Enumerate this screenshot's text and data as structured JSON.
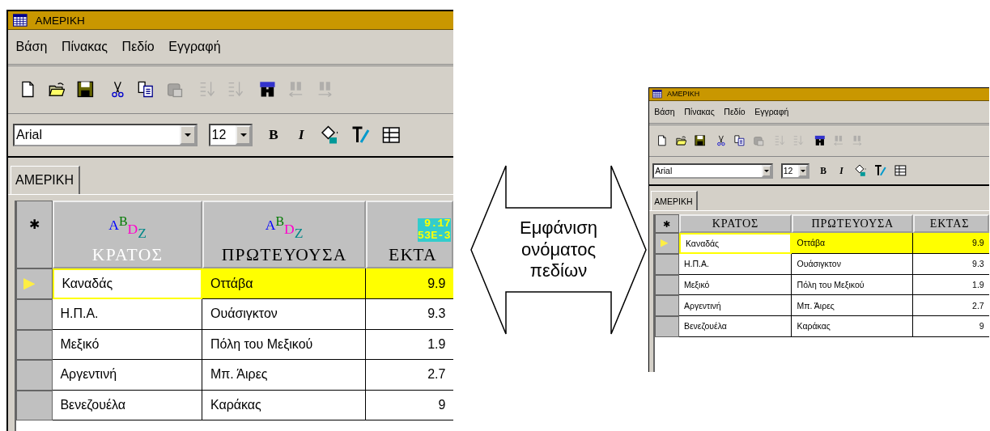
{
  "windows": [
    {
      "kind": "large",
      "title": "ΑΜΕΡΙΚΗ",
      "menu": [
        "Βάση",
        "Πίνακας",
        "Πεδίο",
        "Εγγραφή"
      ],
      "toolbar": [
        [
          {
            "kind": "new",
            "disabled": false
          },
          {
            "kind": "open",
            "disabled": false
          },
          {
            "kind": "save",
            "disabled": false
          }
        ],
        [
          {
            "kind": "cut",
            "disabled": false
          },
          {
            "kind": "copy",
            "disabled": false
          },
          {
            "kind": "paste",
            "disabled": true
          }
        ],
        [
          {
            "kind": "sort_asc",
            "disabled": true
          },
          {
            "kind": "sort_desc",
            "disabled": true
          }
        ],
        [
          {
            "kind": "find",
            "disabled": false
          },
          {
            "kind": "find_prev",
            "disabled": true
          },
          {
            "kind": "find_next",
            "disabled": true
          }
        ]
      ],
      "font_field": "Arial",
      "size_field": "12",
      "style_buttons": [
        {
          "kind": "bold",
          "label": "B"
        },
        {
          "kind": "italic",
          "label": "I"
        }
      ],
      "format_tools": [
        {
          "kind": "fill"
        },
        {
          "kind": "text_color"
        },
        {
          "kind": "grid"
        }
      ],
      "tabs": [
        {
          "label": "ΑΜΕΡΙΚΗ",
          "selected": true
        }
      ],
      "corner": "✱",
      "columns": [
        {
          "label": "ΚΡΑΤΟΣ",
          "dimmed": true,
          "type_icon": "ABDZ"
        },
        {
          "label": "ΠΡΩΤΕΥΟΥΣΑ",
          "dimmed": false,
          "type_icon": "ABDZ"
        },
        {
          "label": "ΕΚΤΑ",
          "dimmed": false,
          "number_icon": [
            "9.17",
            "53E-3"
          ]
        }
      ],
      "rows": [
        {
          "selected": true,
          "cells": [
            "Καναδάς",
            "Οττάβα",
            "9.9"
          ]
        },
        {
          "selected": false,
          "cells": [
            "Η.Π.Α.",
            "Ουάσιγκτον",
            "9.3"
          ]
        },
        {
          "selected": false,
          "cells": [
            "Μεξικό",
            "Πόλη του Μεξικού",
            "1.9"
          ]
        },
        {
          "selected": false,
          "cells": [
            "Αργεντινή",
            "Μπ. Άιρες",
            "2.7"
          ]
        },
        {
          "selected": false,
          "cells": [
            "Βενεζουέλα",
            "Καράκας",
            "9"
          ]
        }
      ]
    },
    {
      "kind": "small",
      "title": "ΑΜΕΡΙΚΗ",
      "menu": [
        "Βάση",
        "Πίνακας",
        "Πεδίο",
        "Εγγραφή"
      ],
      "toolbar": [
        [
          {
            "kind": "new",
            "disabled": false
          },
          {
            "kind": "open",
            "disabled": false
          },
          {
            "kind": "save",
            "disabled": false
          }
        ],
        [
          {
            "kind": "cut",
            "disabled": false
          },
          {
            "kind": "copy",
            "disabled": false
          },
          {
            "kind": "paste",
            "disabled": true
          }
        ],
        [
          {
            "kind": "sort_asc",
            "disabled": true
          },
          {
            "kind": "sort_desc",
            "disabled": true
          }
        ],
        [
          {
            "kind": "find",
            "disabled": false
          },
          {
            "kind": "find_prev",
            "disabled": true
          },
          {
            "kind": "find_next",
            "disabled": true
          }
        ]
      ],
      "font_field": "Arial",
      "size_field": "12",
      "style_buttons": [
        {
          "kind": "bold",
          "label": "B"
        },
        {
          "kind": "italic",
          "label": "I"
        }
      ],
      "format_tools": [
        {
          "kind": "fill"
        },
        {
          "kind": "text_color"
        },
        {
          "kind": "grid"
        }
      ],
      "tabs": [
        {
          "label": "ΑΜΕΡΙΚΗ",
          "selected": true
        }
      ],
      "corner": "✱",
      "columns": [
        {
          "label": "ΚΡΑΤΟΣ",
          "dimmed": false
        },
        {
          "label": "ΠΡΩΤΕΥΟΥΣΑ",
          "dimmed": false
        },
        {
          "label": "ΕΚΤΑΣ",
          "dimmed": false
        }
      ],
      "rows": [
        {
          "selected": true,
          "cells": [
            "Καναδάς",
            "Οττάβα",
            "9.9"
          ]
        },
        {
          "selected": false,
          "cells": [
            "Η.Π.Α.",
            "Ουάσιγκτον",
            "9.3"
          ]
        },
        {
          "selected": false,
          "cells": [
            "Μεξικό",
            "Πόλη του Μεξικού",
            "1.9"
          ]
        },
        {
          "selected": false,
          "cells": [
            "Αργεντινή",
            "Μπ. Άιρες",
            "2.7"
          ]
        },
        {
          "selected": false,
          "cells": [
            "Βενεζουέλα",
            "Καράκας",
            "9"
          ]
        }
      ]
    }
  ],
  "callout": {
    "text": "Εμφάνιση ονόματος πεδίων"
  }
}
